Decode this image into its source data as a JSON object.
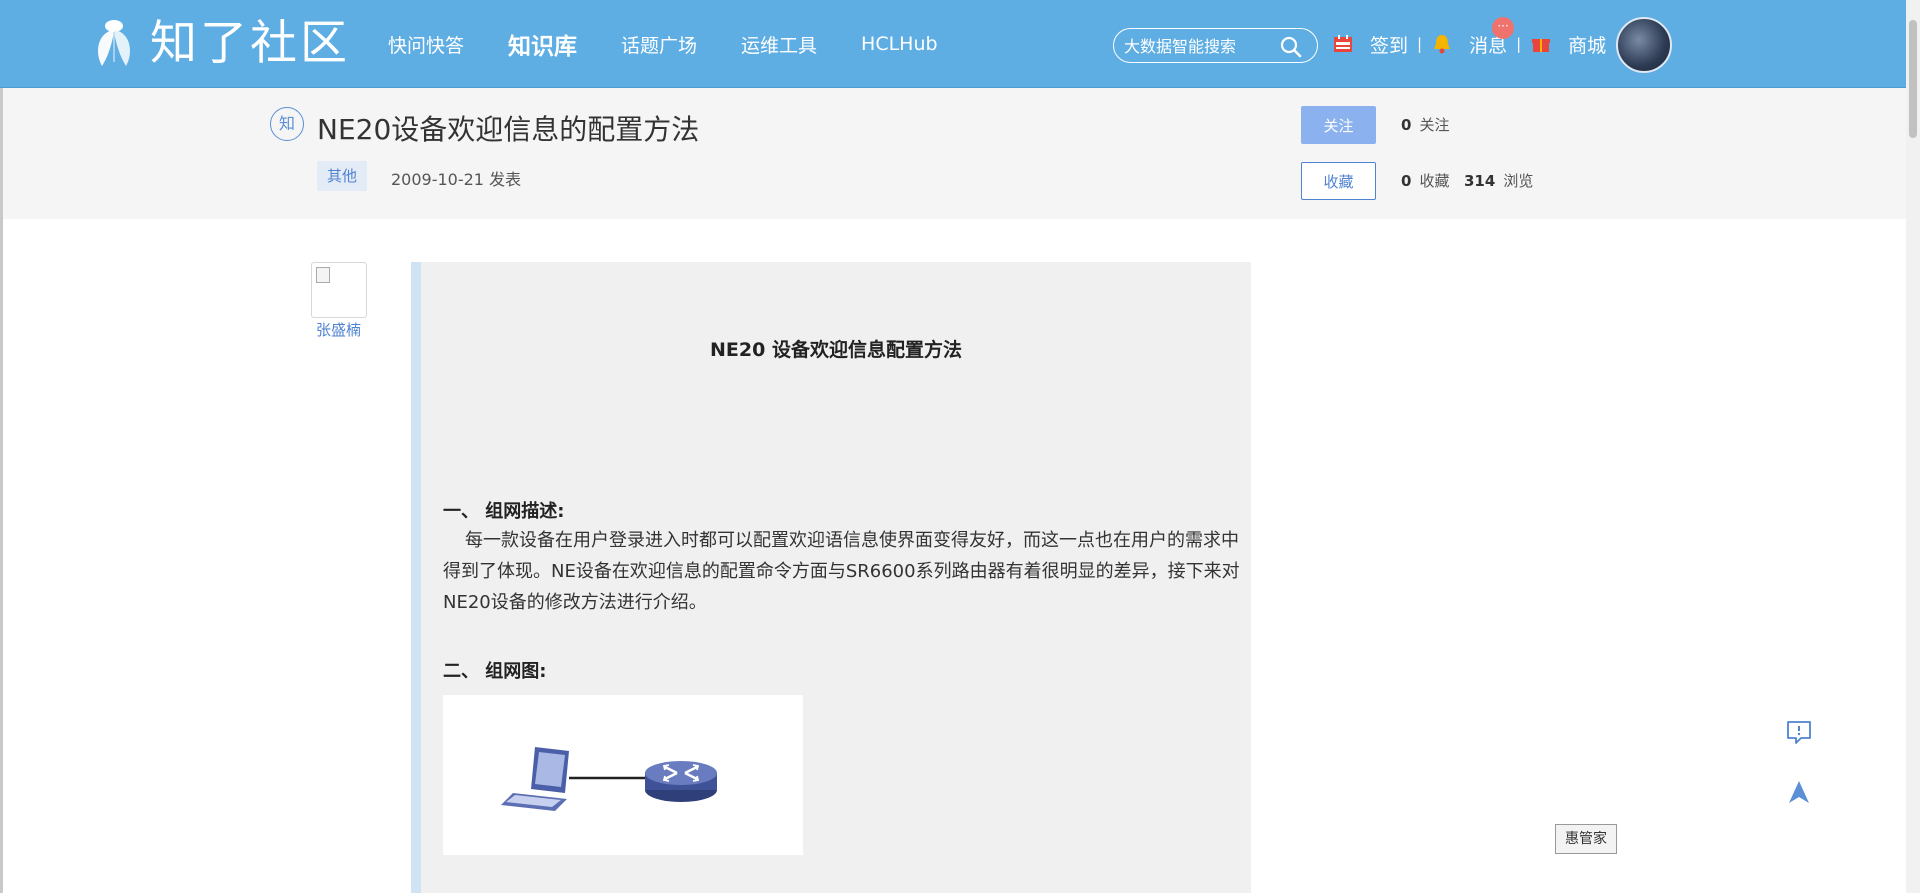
{
  "brand": {
    "name": "知了社区",
    "colors": {
      "header": "#5eaee4",
      "accent": "#4f83d1",
      "button": "#8bb1ee",
      "badge": "#f0726c"
    }
  },
  "nav": {
    "items": [
      {
        "label": "快问快答",
        "active": false
      },
      {
        "label": "知识库",
        "active": true
      },
      {
        "label": "话题广场",
        "active": false
      },
      {
        "label": "运维工具",
        "active": false
      },
      {
        "label": "HCLHub",
        "active": false
      }
    ]
  },
  "search": {
    "placeholder": "大数据智能搜索",
    "icon": "search-icon"
  },
  "user_links": {
    "checkin": "签到",
    "separator": "|",
    "messages": "消息",
    "messages_badge": "···",
    "mall": "商城"
  },
  "article": {
    "badge": "知",
    "title": "NE20设备欢迎信息的配置方法",
    "tag": "其他",
    "date": "2009-10-21 发表",
    "follow_label": "关注",
    "collect_label": "收藏",
    "follow_count": "0",
    "follow_text": "关注",
    "collect_count": "0",
    "collect_text": "收藏",
    "view_count": "314",
    "view_text": "浏览"
  },
  "author": {
    "name": "张盛楠"
  },
  "content": {
    "doc_title": "NE20 设备欢迎信息配置方法",
    "section1": "一、 组网描述:",
    "paragraph1": "每一款设备在用户登录进入时都可以配置欢迎语信息使界面变得友好，而这一点也在用户的需求中得到了体现。NE设备在欢迎信息的配置命令方面与SR6600系列路由器有着很明显的差异，接下来对NE20设备的修改方法进行介绍。",
    "section2": "二、 组网图:"
  },
  "float": {
    "helper": "惠管家"
  }
}
